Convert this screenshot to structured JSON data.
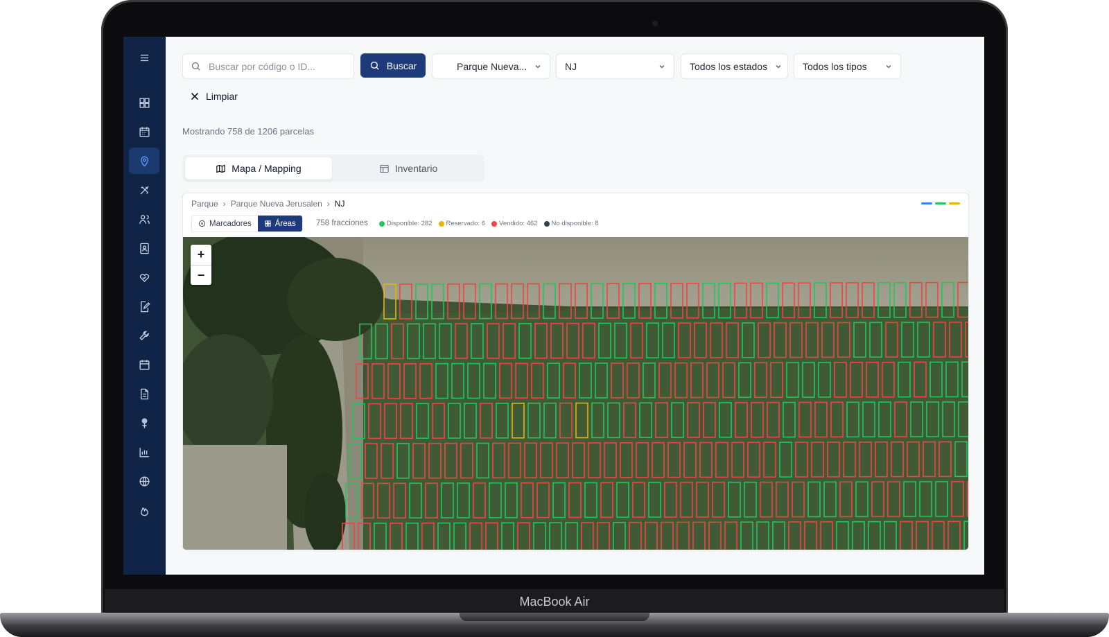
{
  "device": {
    "label": "MacBook Air"
  },
  "sidebar": {
    "items": [
      {
        "icon": "menu-icon"
      },
      {
        "icon": "dashboard-icon"
      },
      {
        "icon": "calendar-icon"
      },
      {
        "icon": "map-pin-icon",
        "active": true
      },
      {
        "icon": "tools-icon"
      },
      {
        "icon": "users-icon"
      },
      {
        "icon": "contact-card-icon"
      },
      {
        "icon": "heart-hand-icon"
      },
      {
        "icon": "edit-document-icon"
      },
      {
        "icon": "wrench-icon"
      },
      {
        "icon": "calendar-small-icon"
      },
      {
        "icon": "file-icon"
      },
      {
        "icon": "flower-icon"
      },
      {
        "icon": "bar-chart-icon"
      },
      {
        "icon": "globe-icon"
      },
      {
        "icon": "flame-icon"
      }
    ]
  },
  "filters": {
    "search_placeholder": "Buscar por código o ID...",
    "search_button": "Buscar",
    "park": "Parque Nueva...",
    "zone": "NJ",
    "status": "Todos los estados",
    "type": "Todos los tipos",
    "clear": "Limpiar"
  },
  "summary": {
    "text": "Mostrando 758 de 1206 parcelas"
  },
  "tabs": {
    "map": "Mapa / Mapping",
    "inventory": "Inventario"
  },
  "panel": {
    "breadcrumb": [
      "Parque",
      "Parque Nueva Jerusalen",
      "NJ"
    ],
    "view_toggle": {
      "markers": "Marcadores",
      "areas": "Áreas"
    },
    "fractions": "758 fracciones",
    "legend": [
      {
        "label": "Disponible: 282",
        "color": "#22c55e"
      },
      {
        "label": "Reservado: 6",
        "color": "#eab308"
      },
      {
        "label": "Vendido: 462",
        "color": "#ef4444"
      },
      {
        "label": "No disponible: 8",
        "color": "#374151"
      }
    ],
    "accent_bars": [
      "#3b82f6",
      "#22c55e",
      "#eab308"
    ],
    "zoom": {
      "in": "+",
      "out": "−"
    }
  },
  "colors": {
    "sidebar": "#0f2447",
    "primary": "#1e3a7b",
    "available": "#22c55e",
    "reserved": "#eab308",
    "sold": "#ef4444"
  }
}
